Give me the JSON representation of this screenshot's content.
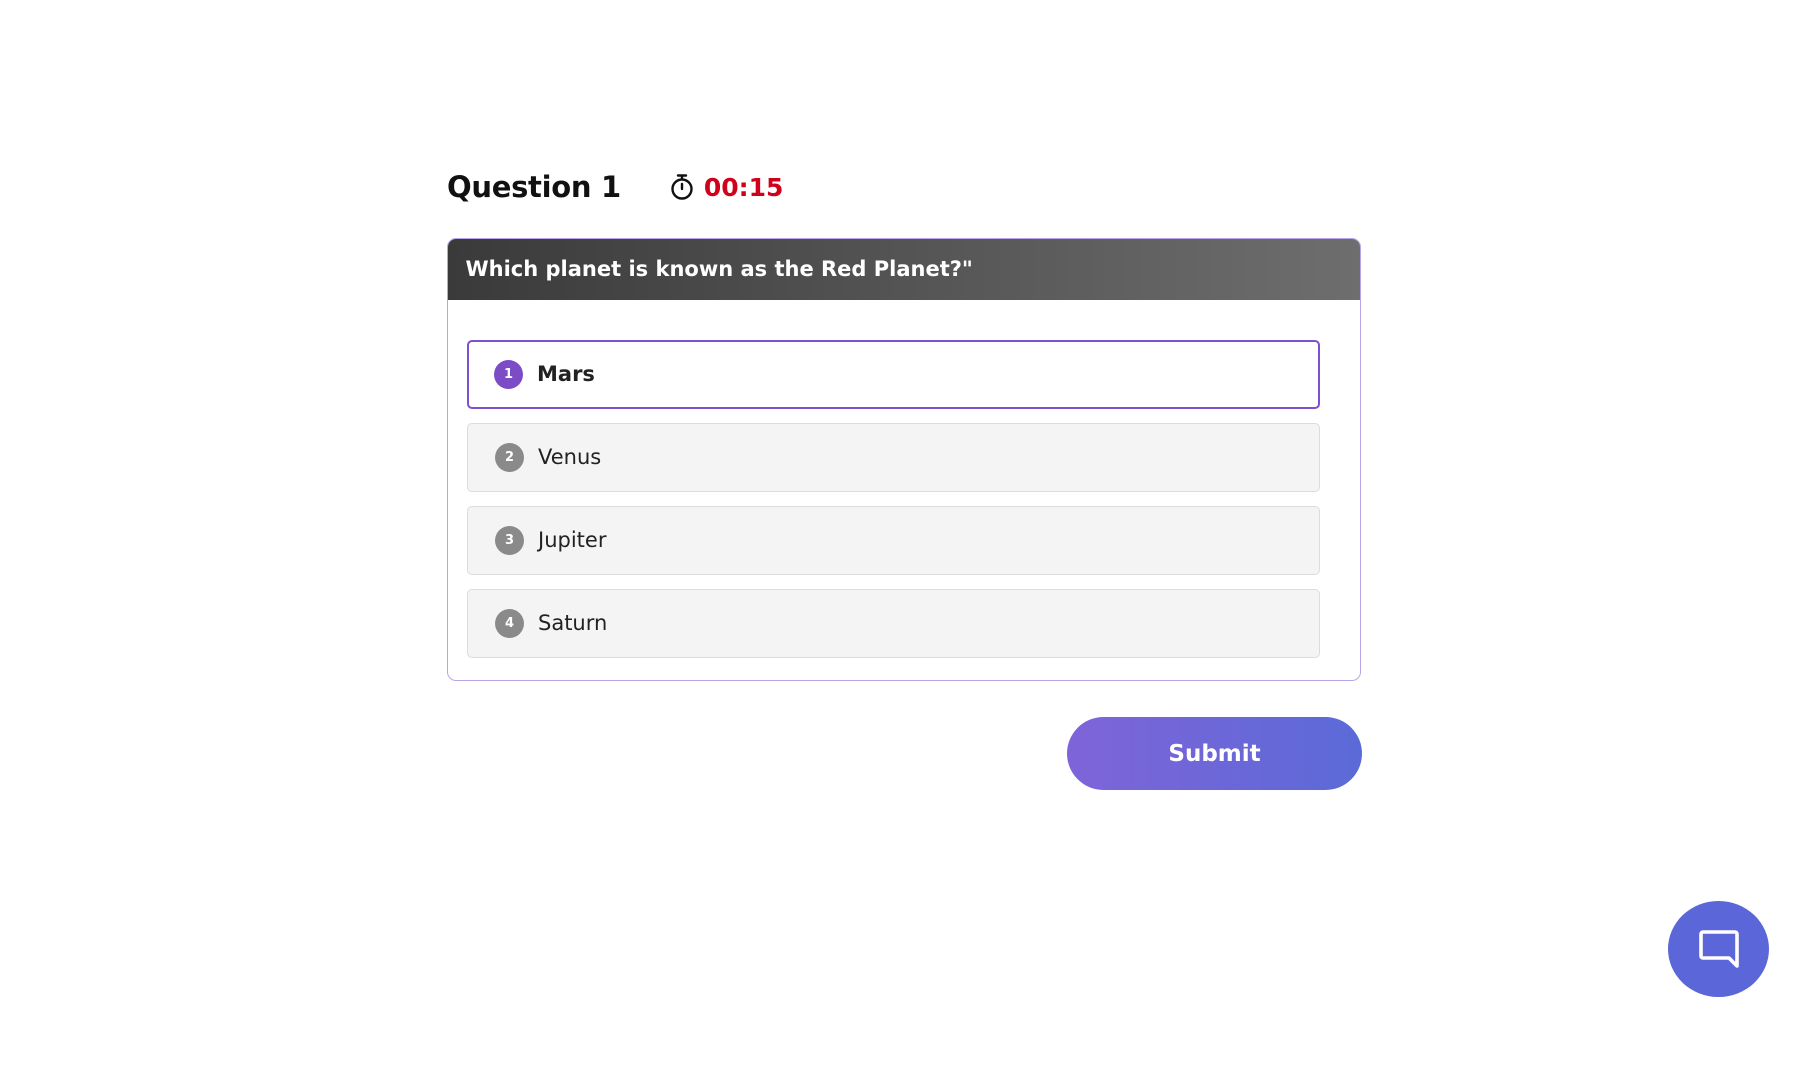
{
  "quiz": {
    "question_label": "Question 1",
    "timer": {
      "icon": "stopwatch-icon",
      "value": "00:15",
      "color": "#d0021b"
    },
    "question_text": "Which planet is known as the Red Planet?\"",
    "options": [
      {
        "number": "1",
        "label": "Mars",
        "selected": true
      },
      {
        "number": "2",
        "label": "Venus",
        "selected": false
      },
      {
        "number": "3",
        "label": "Jupiter",
        "selected": false
      },
      {
        "number": "4",
        "label": "Saturn",
        "selected": false
      }
    ],
    "submit_label": "Submit"
  },
  "chat_widget": {
    "icon": "chat-bubble-icon",
    "color": "#5b66d8"
  },
  "colors": {
    "accent": "#7b4cc6",
    "submit_gradient_start": "#7f64d9",
    "submit_gradient_end": "#5b6ad7",
    "header_dark": "#3a3a3a"
  }
}
